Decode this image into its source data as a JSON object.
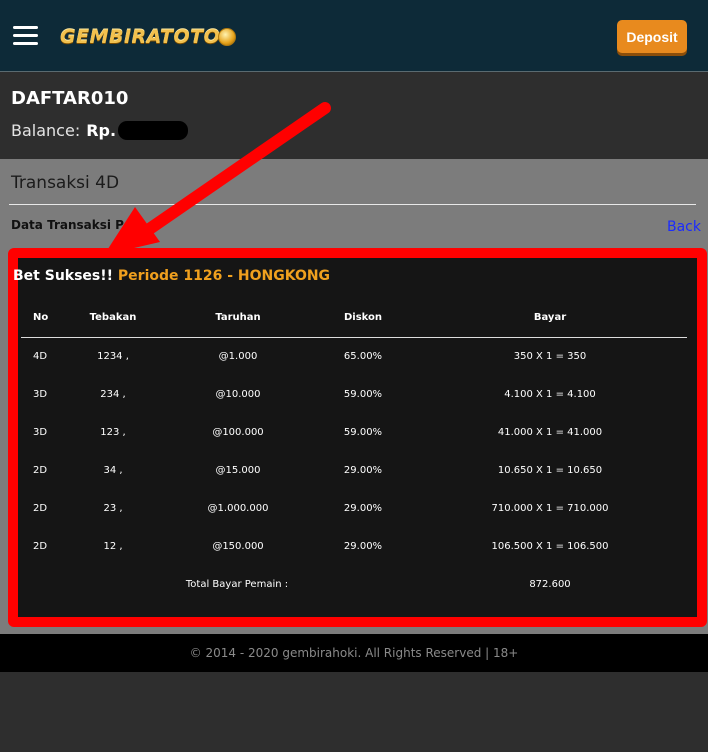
{
  "header": {
    "logo_text": "GEMBIRATOTO",
    "deposit_label": "Deposit",
    "menu_icon": "hamburger-menu-icon"
  },
  "account": {
    "username": "DAFTAR010",
    "balance_label": "Balance:",
    "balance_currency": "Rp."
  },
  "panel": {
    "title": "Transaksi 4D",
    "data_label": "Data Transaksi Pem",
    "back_label": "Back"
  },
  "bet": {
    "success": "Bet Sukses!!",
    "period": "Periode 1126 - HONGKONG",
    "columns": [
      "No",
      "Tebakan",
      "Taruhan",
      "Diskon",
      "Bayar"
    ],
    "rows": [
      {
        "no": "4D",
        "tebakan": "1234 ,",
        "taruhan": "@1.000",
        "diskon": "65.00%",
        "bayar": "350 X 1 = 350"
      },
      {
        "no": "3D",
        "tebakan": "234 ,",
        "taruhan": "@10.000",
        "diskon": "59.00%",
        "bayar": "4.100 X 1 = 4.100"
      },
      {
        "no": "3D",
        "tebakan": "123 ,",
        "taruhan": "@100.000",
        "diskon": "59.00%",
        "bayar": "41.000 X 1 = 41.000"
      },
      {
        "no": "2D",
        "tebakan": "34 ,",
        "taruhan": "@15.000",
        "diskon": "29.00%",
        "bayar": "10.650 X 1 = 10.650"
      },
      {
        "no": "2D",
        "tebakan": "23 ,",
        "taruhan": "@1.000.000",
        "diskon": "29.00%",
        "bayar": "710.000 X 1 = 710.000"
      },
      {
        "no": "2D",
        "tebakan": "12 ,",
        "taruhan": "@150.000",
        "diskon": "29.00%",
        "bayar": "106.500 X 1 = 106.500"
      }
    ],
    "total_label": "Total Bayar Pemain :",
    "total_value": "872.600"
  },
  "footer": {
    "text": "© 2014 - 2020 gembirahoki. All Rights Reserved | 18+"
  },
  "colors": {
    "topbar": "#0d2a38",
    "deposit": "#e88a1e",
    "highlight": "#ff0000",
    "period": "#f0a01e",
    "back_link": "#1b2bff"
  }
}
